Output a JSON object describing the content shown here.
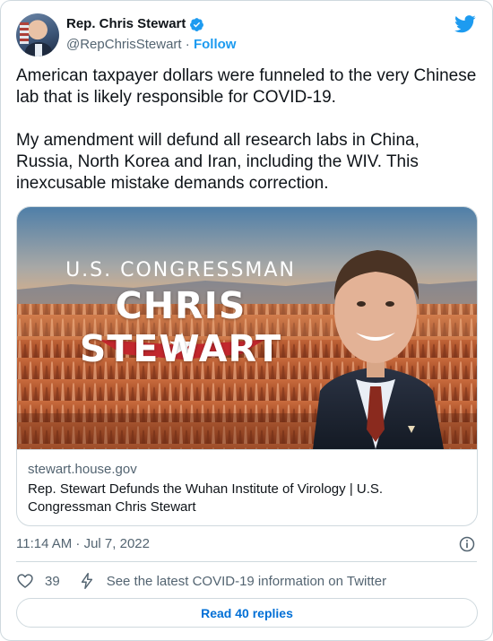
{
  "author": {
    "name": "Rep. Chris Stewart",
    "handle": "@RepChrisStewart",
    "separator": " · ",
    "follow_label": "Follow"
  },
  "tweet": {
    "text": "American taxpayer dollars were funneled to the very Chinese lab that is likely responsible for COVID-19.\n\nMy amendment will defund all research labs in China, Russia, North Korea and Iran, including the WIV. This inexcusable mistake demands correction."
  },
  "card": {
    "banner_subtitle": "U.S. CONGRESSMAN",
    "banner_title": "CHRIS STEWART",
    "domain": "stewart.house.gov",
    "title": "Rep. Stewart Defunds the Wuhan Institute of Virology | U.S. Congressman Chris Stewart"
  },
  "meta": {
    "timestamp": "11:14 AM · Jul 7, 2022"
  },
  "actions": {
    "like_count": "39",
    "covid_link": "See the latest COVID-19 information on Twitter",
    "read_replies": "Read 40 replies"
  },
  "icons": {
    "verified": "verified-badge-icon",
    "brand": "twitter-bird-icon",
    "info": "info-icon",
    "like": "heart-icon",
    "covid": "lightning-icon"
  },
  "colors": {
    "accent": "#1d9bf0",
    "link": "#006fd6",
    "muted": "#536471",
    "border": "#cfd9de"
  }
}
